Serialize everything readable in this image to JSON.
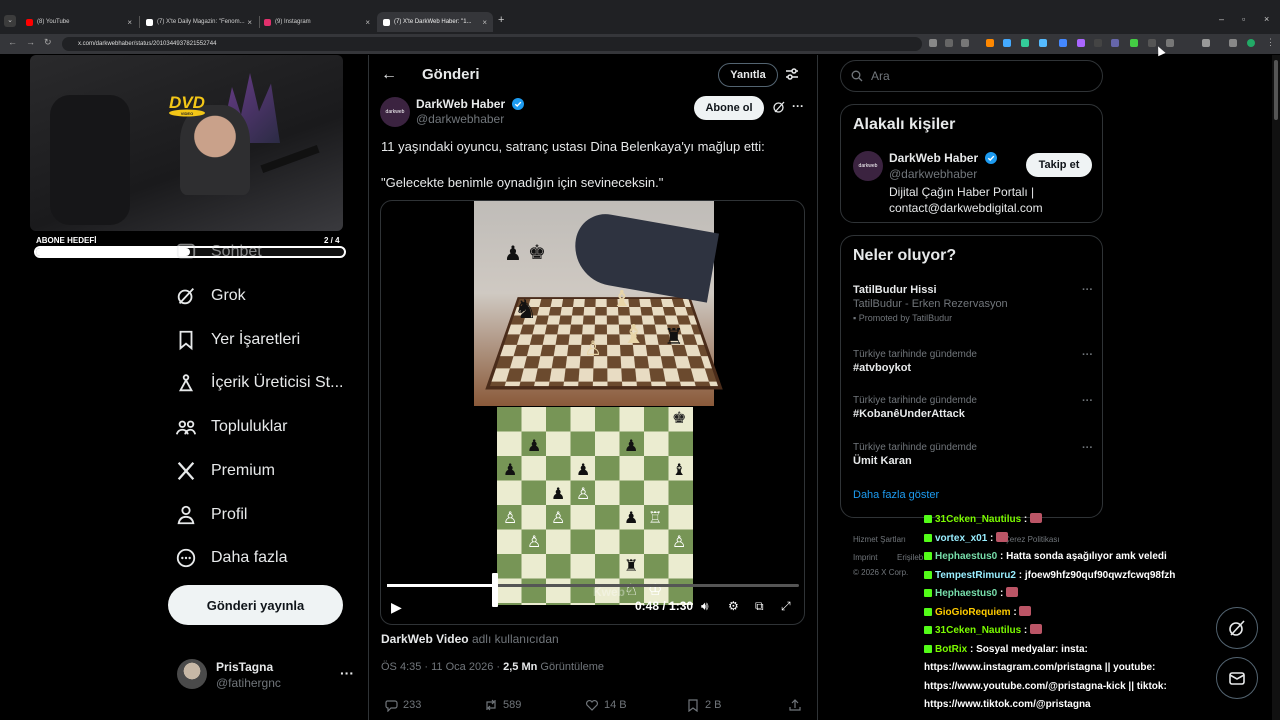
{
  "browser": {
    "tabs": [
      {
        "label": "(8) YouTube",
        "color": "#ff0000"
      },
      {
        "label": "(7) X'te Daily Magazin: \"Fenom...",
        "color": "#ffffff"
      },
      {
        "label": "(9) Instagram",
        "color": "#e1306c"
      },
      {
        "label": "(7) X'te DarkWeb Haber: \"1...",
        "color": "#ffffff"
      }
    ],
    "url": "x.com/darkwebhaber/status/2010344937821552744"
  },
  "stream": {
    "dvd_label": "DVD",
    "dvd_sub": "VIDEO",
    "goal_label": "ABONE HEDEFİ",
    "goal_count": "2 / 4",
    "goal_progress": 0.5
  },
  "nav": {
    "items": [
      {
        "label": "Sohbet",
        "icon": "chat-icon"
      },
      {
        "label": "Grok",
        "icon": "grok-icon"
      },
      {
        "label": "Yer İşaretleri",
        "icon": "bookmark-icon"
      },
      {
        "label": "İçerik Üreticisi St...",
        "icon": "creator-studio-icon"
      },
      {
        "label": "Topluluklar",
        "icon": "communities-icon"
      },
      {
        "label": "Premium",
        "icon": "x-logo-icon"
      },
      {
        "label": "Profil",
        "icon": "profile-icon"
      },
      {
        "label": "Daha fazla",
        "icon": "more-circle-icon"
      }
    ],
    "post_button": "Gönderi yayınla",
    "account": {
      "name": "PrisTagna",
      "handle": "@fatihergnc",
      "more": "···"
    }
  },
  "post": {
    "back": "←",
    "title": "Gönderi",
    "reply_button": "Yanıtla",
    "author": {
      "name": "DarkWeb Haber",
      "handle": "@darkwebhaber",
      "avatar_text": "darkweb"
    },
    "subscribe_button": "Abone ol",
    "more": "···",
    "text1": "11 yaşındaki oyuncu, satranç ustası Dina Belenkaya'yı mağlup etti:",
    "text2": "\"Gelecekte benimle oynadığın için sevineceksin.\"",
    "video": {
      "time": "0:48 / 1:30",
      "progress": 0.256,
      "watermark": "Kweb"
    },
    "from_name": "DarkWeb Video",
    "from_suffix": "adlı kullanıcıdan",
    "date": "ÖS 4:35 · 11 Oca 2026 · ",
    "views": "2,5 Mn",
    "views_label": "Görüntüleme",
    "actions": [
      {
        "icon": "reply-icon",
        "count": "233"
      },
      {
        "icon": "repost-icon",
        "count": "589"
      },
      {
        "icon": "like-icon",
        "count": "14 B"
      },
      {
        "icon": "bookmark-icon",
        "count": "2 B"
      },
      {
        "icon": "share-icon",
        "count": ""
      }
    ]
  },
  "sidebar": {
    "search_placeholder": "Ara",
    "related_title": "Alakalı kişiler",
    "related": {
      "name": "DarkWeb Haber",
      "handle": "@darkwebhaber",
      "bio": "Dijital Çağın Haber Portalı | contact@darkwebdigital.com",
      "follow_button": "Takip et",
      "avatar_text": "darkweb"
    },
    "trends_title": "Neler oluyor?",
    "promo": {
      "title": "TatilBudur Hissi",
      "sub": "TatilBudur - Erken Rezervasyon",
      "promoted": "Promoted by TatilBudur"
    },
    "trends": [
      {
        "context": "Türkiye tarihinde gündemde",
        "title": "#atvboykot"
      },
      {
        "context": "Türkiye tarihinde gündemde",
        "title": "#KobanêUnderAttack"
      },
      {
        "context": "Türkiye tarihinde gündemde",
        "title": "Ümit Karan"
      }
    ],
    "show_more": "Daha fazla göster",
    "footer": {
      "line1a": "Hizmet Şartları",
      "line1b": "Çerez Politikası",
      "line2a": "Imprint",
      "line2b": "Erişileb",
      "line3": "© 2026 X Corp."
    }
  },
  "chat": [
    {
      "user": "31Ceken_Nautilus",
      "msg": "",
      "cls": "u1"
    },
    {
      "user": "vortex_x01",
      "msg": "",
      "cls": "u2"
    },
    {
      "user": "Hephaestus0",
      "msg": "Hatta sonda aşağılıyor amk veledi",
      "cls": "u5"
    },
    {
      "user": "TempestRimuru2",
      "msg": "jfoew9hfz90quf90qwzfcwq98fzh",
      "cls": "u2"
    },
    {
      "user": "Hephaestus0",
      "msg": "",
      "cls": "u5"
    },
    {
      "user": "GioGioRequiem",
      "msg": "",
      "cls": "u4"
    },
    {
      "user": "31Ceken_Nautilus",
      "msg": "",
      "cls": "u1"
    },
    {
      "user": "BotRix",
      "msg": "Sosyal medyalar: insta: https://www.instagram.com/pristagna || youtube: https://www.youtube.com/@pristagna-kick || tiktok: https://www.tiktok.com/@pristagna",
      "cls": "u1"
    }
  ]
}
